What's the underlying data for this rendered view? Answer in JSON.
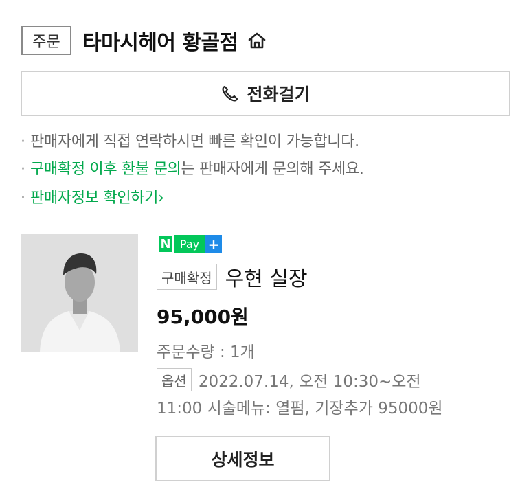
{
  "header": {
    "order_badge": "주문",
    "store_name": "타마시헤어 황골점",
    "home_icon": "home-icon"
  },
  "call_button": {
    "label": "전화걸기",
    "icon": "phone-icon"
  },
  "notices": {
    "bullet": "·",
    "line1": "판매자에게 직접 연락하시면 빠른 확인이 가능합니다.",
    "line2_link": "구매확정 이후 환불 문의",
    "line2_rest": "는 판매자에게 문의해 주세요.",
    "line3_link": "판매자정보 확인하기",
    "line3_chevron": "›"
  },
  "product": {
    "image_icon": "person-photo",
    "npay": {
      "n": "N",
      "pay": "Pay",
      "plus": "+"
    },
    "status_badge": "구매확정",
    "name": "우현 실장",
    "price": "95,000원",
    "quantity": "주문수량 : 1개",
    "option_badge": "옵션",
    "option_line1": "2022.07.14, 오전 10:30~오전",
    "option_line2": "11:00 시술메뉴: 열펌, 기장추가 95000원"
  },
  "detail_button": {
    "label": "상세정보"
  },
  "colors": {
    "green": "#03a94d",
    "npay_green": "#03c75a",
    "npay_blue": "#1e8be8",
    "border": "#d0d0d0"
  }
}
